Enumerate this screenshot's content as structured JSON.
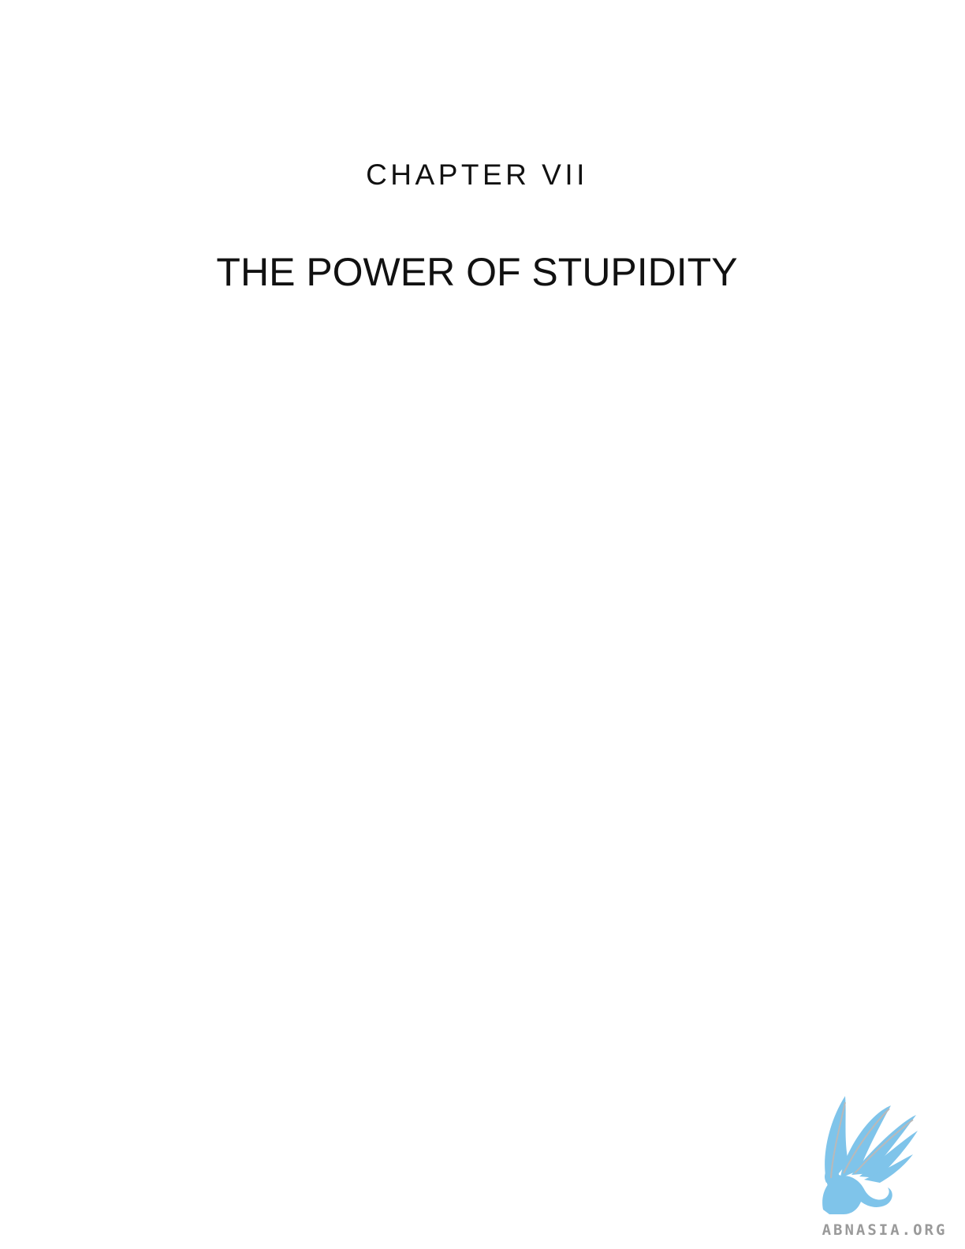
{
  "chapter": {
    "number_label": "CHAPTER VII",
    "title": "THE POWER OF STUPIDITY"
  },
  "watermark": {
    "text": "ABNASIA.ORG",
    "logo_icon": "griffin-logo-icon",
    "logo_color": "#7fc4ea",
    "text_color": "#9a9a9a"
  }
}
